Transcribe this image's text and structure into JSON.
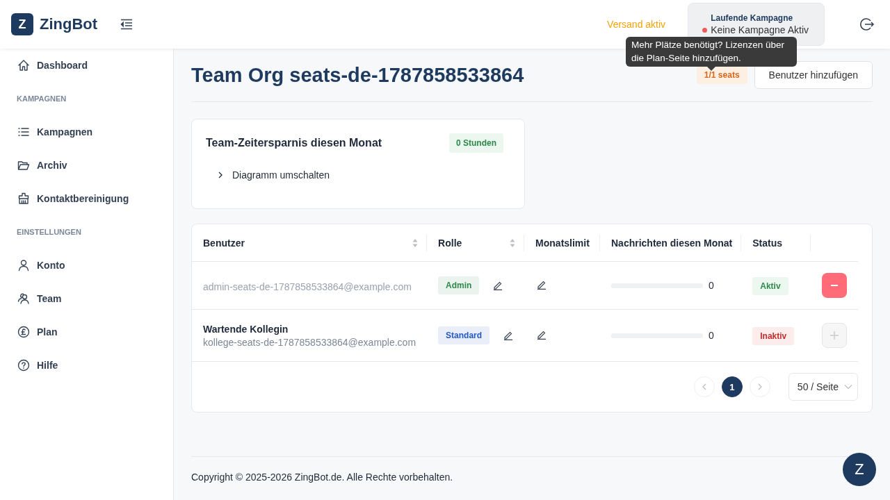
{
  "brand": {
    "logo_letter": "Z",
    "name": "ZingBot"
  },
  "header": {
    "sending_status": "Versand aktiv",
    "campaign": {
      "label": "Laufende Kampagne",
      "value": "Keine Kampagne Aktiv",
      "running": false
    },
    "tooltip": "Mehr Plätze benötigt? Lizenzen über die Plan-Seite hinzufügen."
  },
  "sidebar": [
    {
      "kind": "item",
      "label": "Dashboard",
      "selected": false
    },
    {
      "kind": "section",
      "label": "KAMPAGNEN"
    },
    {
      "kind": "item",
      "label": "Kampagnen",
      "selected": false
    },
    {
      "kind": "item",
      "label": "Archiv",
      "selected": false
    },
    {
      "kind": "item",
      "label": "Kontaktbereinigung",
      "selected": false
    },
    {
      "kind": "section",
      "label": "EINSTELLUNGEN"
    },
    {
      "kind": "item",
      "label": "Konto",
      "selected": false
    },
    {
      "kind": "item",
      "label": "Team",
      "selected": false
    },
    {
      "kind": "item",
      "label": "Plan",
      "selected": false
    },
    {
      "kind": "item",
      "label": "Hilfe",
      "selected": false
    }
  ],
  "page": {
    "title": "Team Org seats-de-1787858533864",
    "seats": "1/1 seats",
    "add_button": "Benutzer hinzufügen"
  },
  "savings_card": {
    "title": "Team-Zeitersparnis diesen Monat",
    "badge": "0 Stunden",
    "toggle": "Diagramm umschalten",
    "expanded": false
  },
  "table": {
    "columns": [
      {
        "label": "Benutzer",
        "sortable": true
      },
      {
        "label": "Rolle",
        "sortable": true
      },
      {
        "label": "Monatslimit",
        "sortable": false
      },
      {
        "label": "Nachrichten diesen Monat",
        "sortable": false
      },
      {
        "label": "Status",
        "sortable": false
      }
    ],
    "rows": [
      {
        "name": null,
        "email": "admin-seats-de-1787858533864@example.com",
        "muted": true,
        "role": {
          "label": "Admin",
          "color": "#2d8a4a"
        },
        "level": 0,
        "count": "0",
        "status": "Aktiv",
        "active": true,
        "removable": true
      },
      {
        "name": "Wartende Kollegin",
        "email": "kollege-seats-de-1787858533864@example.com",
        "muted": false,
        "role": {
          "label": "Standard",
          "color": "#2459c7"
        },
        "level": 0,
        "count": "0",
        "status": "Inaktiv",
        "active": false,
        "removable": false
      }
    ]
  },
  "pagination": {
    "pages": [
      {
        "label": "1",
        "selected": true
      }
    ],
    "prev_disabled": true,
    "next_disabled": true,
    "page_size": "50 / Seite"
  },
  "footer": "Copyright © 2025-2026 ZingBot.de. Alle Rechte vorbehalten.",
  "chat_button": "Z"
}
